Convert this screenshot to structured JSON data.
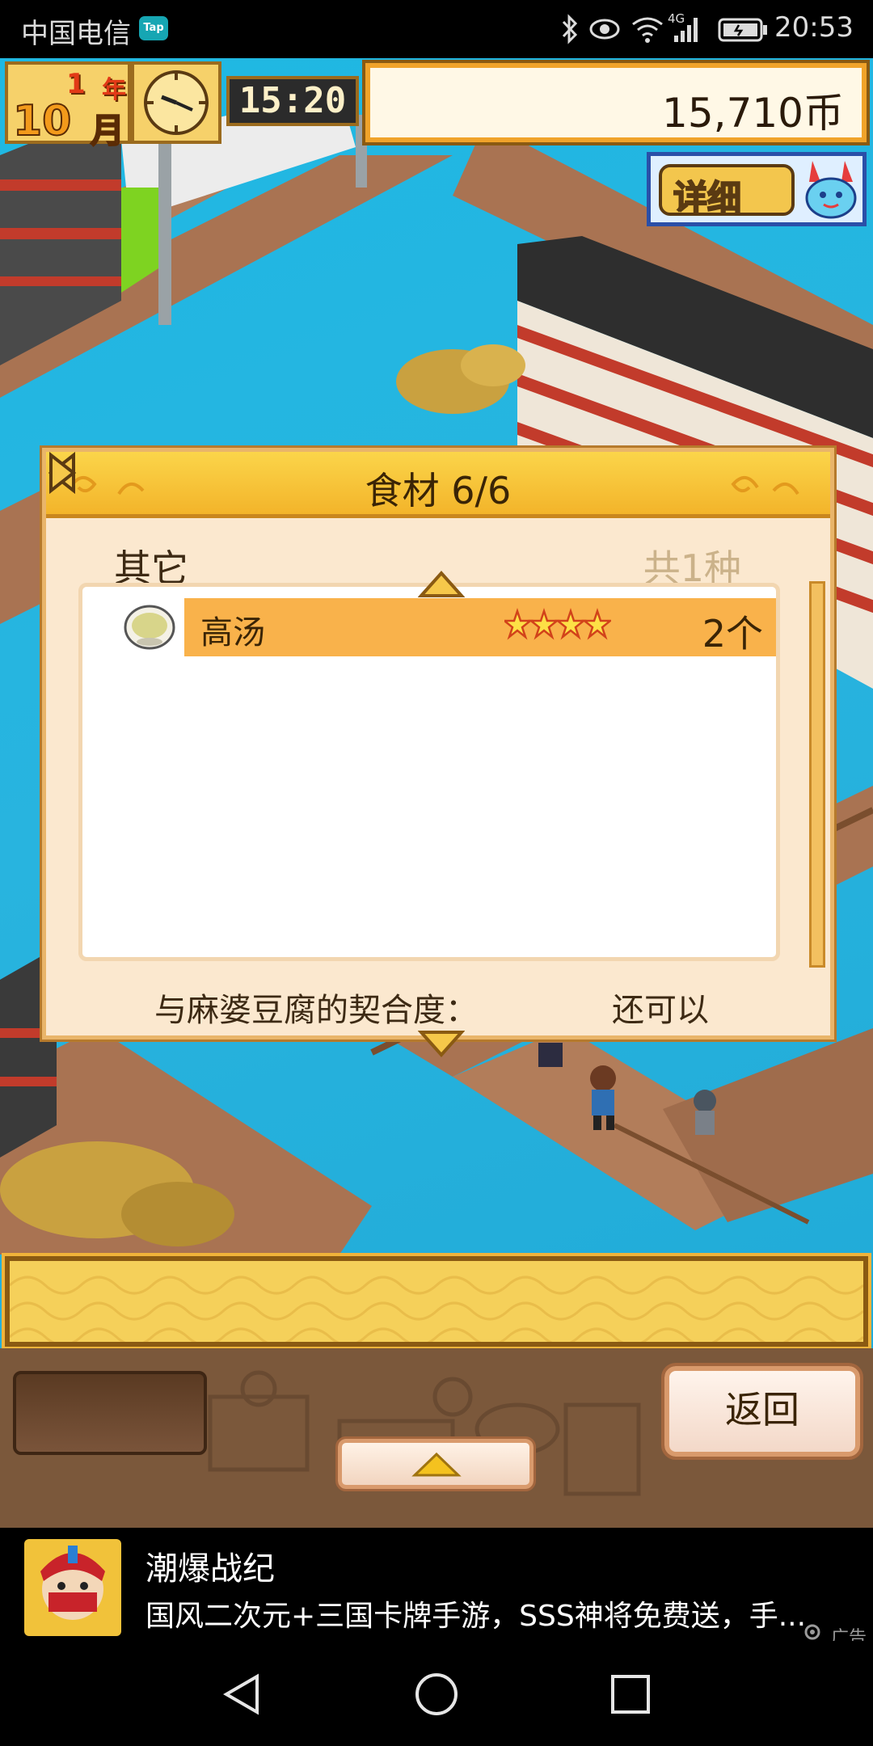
{
  "status_bar": {
    "carrier": "中国电信",
    "app_badge": "Tap",
    "time": "20:53",
    "network": "4G",
    "icons": [
      "bluetooth-icon",
      "eye-icon",
      "wifi-icon",
      "signal-icon",
      "battery-icon"
    ]
  },
  "hud": {
    "year_number": "1",
    "year_unit": "年",
    "month_number": "10",
    "month_unit": "月",
    "game_time": "15:20",
    "money": "15,710币",
    "detail_button": "详细"
  },
  "dialog": {
    "title": "食材 6/6",
    "category": "其它",
    "category_count": "共1种",
    "items": [
      {
        "name": "高汤",
        "stars": 4,
        "quantity": "2个",
        "icon": "soup-bowl-icon"
      }
    ],
    "compatibility_label": "与麻婆豆腐的契合度：",
    "compatibility_value": "还可以"
  },
  "bottom": {
    "back_button": "返回"
  },
  "ad": {
    "title": "潮爆战纪",
    "description": "国风二次元+三国卡牌手游，SSS神将免费送，手...",
    "tag": "广告"
  },
  "colors": {
    "water": "#1fb8e3",
    "accent_gold": "#f3b42a",
    "dialog_bg": "#fbe8cf",
    "selected_row": "#f9b24b"
  }
}
